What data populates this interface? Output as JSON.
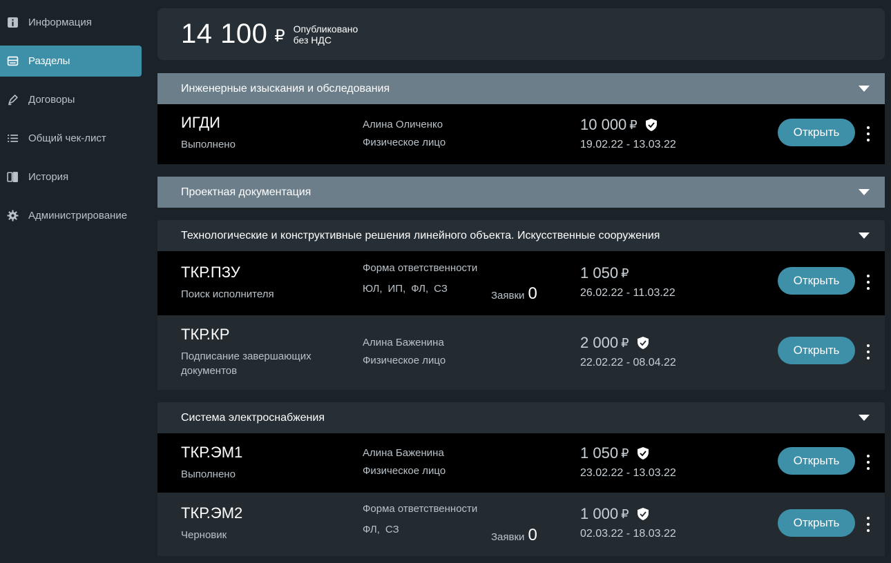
{
  "sidebar": {
    "items": [
      {
        "label": "Информация",
        "icon": "info-icon",
        "active": false
      },
      {
        "label": "Разделы",
        "icon": "sections-icon",
        "active": true
      },
      {
        "label": "Договоры",
        "icon": "pen-icon",
        "active": false
      },
      {
        "label": "Общий чек-лист",
        "icon": "checklist-icon",
        "active": false
      },
      {
        "label": "История",
        "icon": "history-icon",
        "active": false
      },
      {
        "label": "Администрирование",
        "icon": "gear-icon",
        "active": false
      }
    ]
  },
  "summary": {
    "amount": "14 100",
    "currency": "₽",
    "note_line1": "Опубликовано",
    "note_line2": "без НДС"
  },
  "sections": [
    {
      "title": "Инженерные изыскания и обследования",
      "rows": [
        {
          "code": "ИГДИ",
          "status": "Выполнено",
          "person": "Алина Оличенко",
          "person_type": "Физическое лицо",
          "price": "10 000",
          "currency": "₽",
          "dates": "19.02.22 - 13.03.22",
          "open_label": "Открыть"
        }
      ]
    },
    {
      "title": "Проектная документация",
      "rows": []
    },
    {
      "title": "Технологические и конструктивные решения линейного объекта. Искусственные сооружения",
      "rows": [
        {
          "code": "ТКР.ПЗУ",
          "status": "Поиск исполнителя",
          "forms_label": "Форма ответственности",
          "forms": [
            "ЮЛ,",
            "ИП,",
            "ФЛ,",
            "СЗ"
          ],
          "requests_label": "Заявки",
          "requests_count": "0",
          "price": "1 050",
          "currency": "₽",
          "dates": "26.02.22 - 11.03.22",
          "open_label": "Открыть"
        },
        {
          "code": "ТКР.КР",
          "status": "Подписание завершающих документов",
          "person": "Алина Баженина",
          "person_type": "Физическое лицо",
          "price": "2 000",
          "currency": "₽",
          "dates": "22.02.22 - 08.04.22",
          "open_label": "Открыть"
        }
      ]
    },
    {
      "title": "Система электроснабжения",
      "rows": [
        {
          "code": "ТКР.ЭМ1",
          "status": "Выполнено",
          "person": "Алина Баженина",
          "person_type": "Физическое лицо",
          "price": "1 050",
          "currency": "₽",
          "dates": "23.02.22 - 13.03.22",
          "open_label": "Открыть"
        },
        {
          "code": "ТКР.ЭМ2",
          "status": "Черновик",
          "forms_label": "Форма ответственности",
          "forms": [
            "ФЛ,",
            "СЗ"
          ],
          "requests_label": "Заявки",
          "requests_count": "0",
          "price": "1 000",
          "currency": "₽",
          "dates": "02.03.22 - 18.03.22",
          "open_label": "Открыть"
        }
      ]
    }
  ],
  "colors": {
    "accent": "#3e8fa8",
    "background": "#1b2328"
  }
}
